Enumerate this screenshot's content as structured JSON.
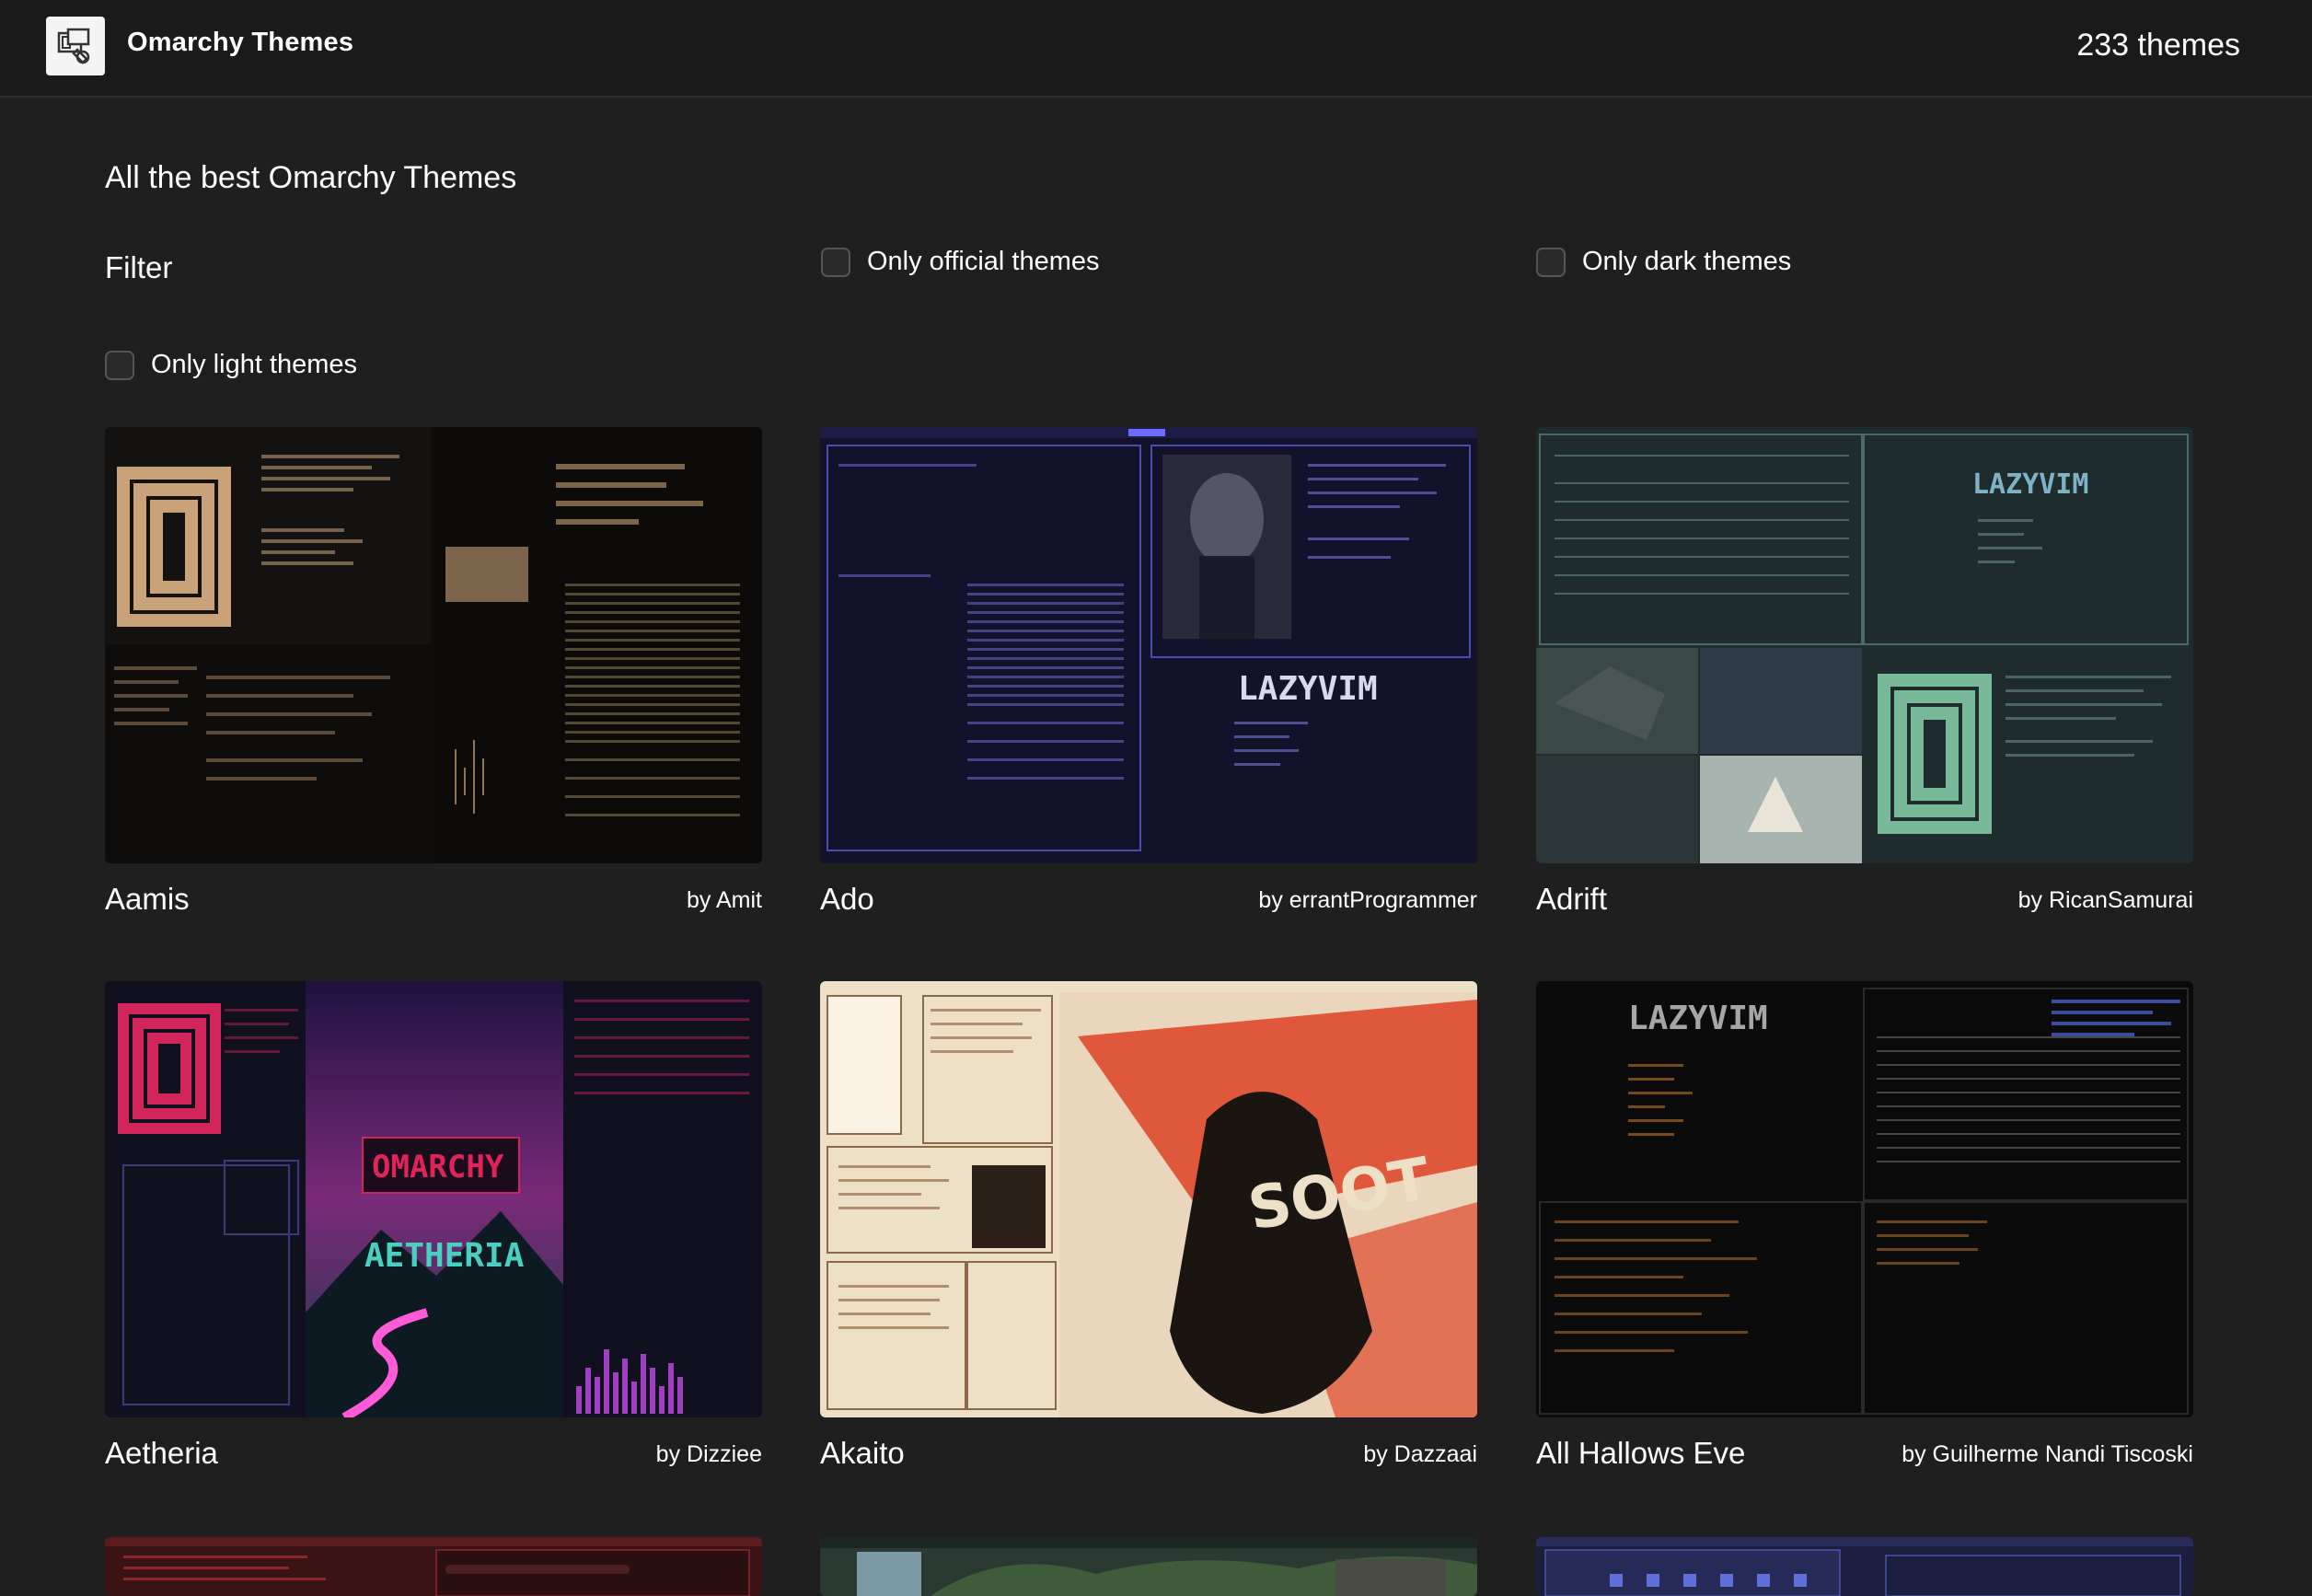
{
  "header": {
    "brand": "Omarchy Themes",
    "count": "233 themes",
    "logo_icon": "theme-logo-icon"
  },
  "page": {
    "title": "All the best Omarchy Themes",
    "filter_label": "Filter"
  },
  "filters": [
    {
      "label": "Only official themes",
      "checked": false
    },
    {
      "label": "Only dark themes",
      "checked": false
    },
    {
      "label": "Only light themes",
      "checked": false
    }
  ],
  "themes": [
    {
      "name": "Aamis",
      "author": "by Amit",
      "accent": "#c9a27a",
      "bg": "#0e0d0b"
    },
    {
      "name": "Ado",
      "author": "by errantProgrammer",
      "accent": "#5a5cd8",
      "bg": "#12122a"
    },
    {
      "name": "Adrift",
      "author": "by RicanSamurai",
      "accent": "#8cc4ae",
      "bg": "#1e2c2e"
    },
    {
      "name": "Aetheria",
      "author": "by Dizziee",
      "accent": "#d0245a",
      "bg": "#10101e"
    },
    {
      "name": "Akaito",
      "author": "by Dazzaai",
      "accent": "#e0583c",
      "bg": "#eedfc7"
    },
    {
      "name": "All Hallows Eve",
      "author": "by Guilherme Nandi Tiscoski",
      "accent": "#e28a2c",
      "bg": "#0b0b0b"
    },
    {
      "name": "",
      "author": "",
      "accent": "#c2323a",
      "bg": "#3a1414"
    },
    {
      "name": "",
      "author": "",
      "accent": "#6f8e6c",
      "bg": "#2a3a32"
    },
    {
      "name": "",
      "author": "",
      "accent": "#5f6fd8",
      "bg": "#1c1e3e"
    }
  ]
}
